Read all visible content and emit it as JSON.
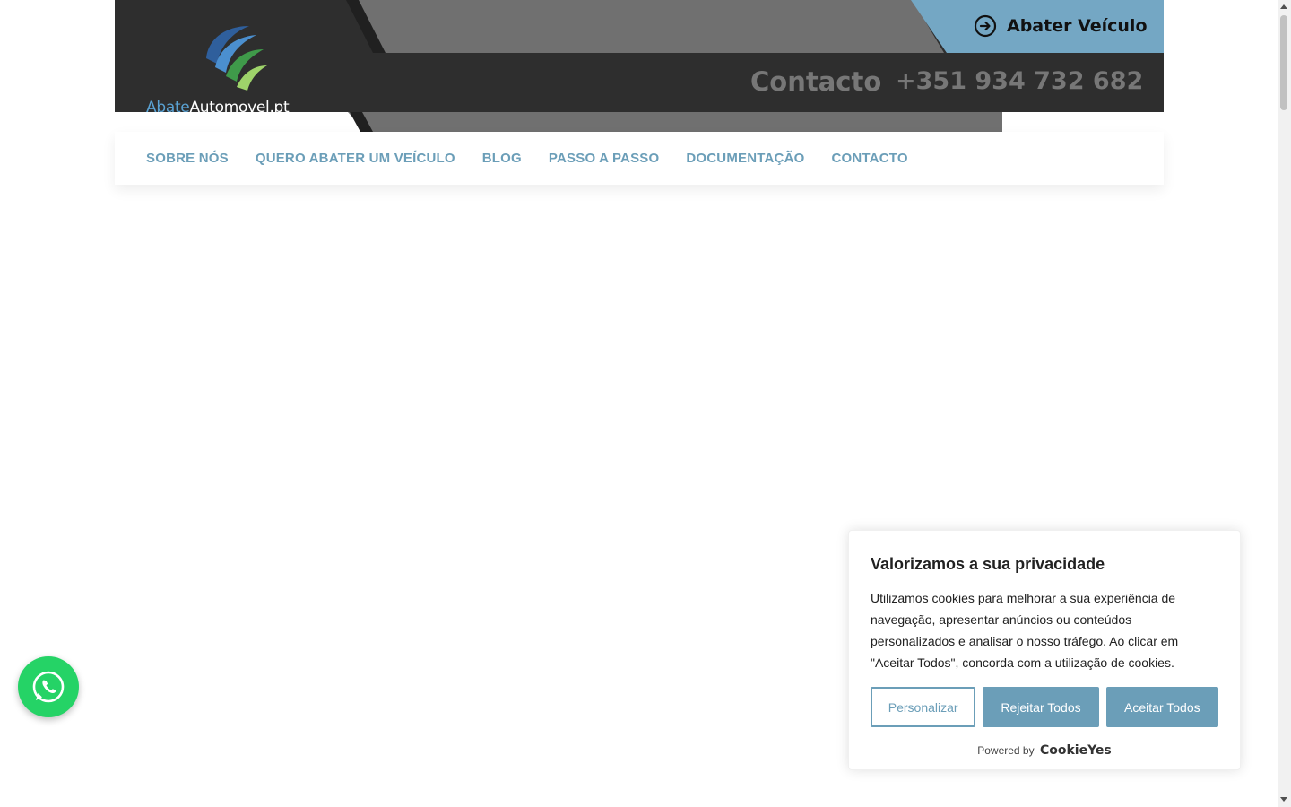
{
  "header": {
    "logo": {
      "part_a": "Abate",
      "part_b": "Automovel.pt",
      "icon": "globe-swoosh-logo"
    },
    "cta": {
      "label": "Abater Veículo",
      "icon": "arrow-circle-right-icon"
    },
    "contact_label": "Contacto",
    "phone": "+351 934 732 682"
  },
  "nav": {
    "items": [
      {
        "label": "SOBRE NÓS"
      },
      {
        "label": "QUERO ABATER UM VEÍCULO"
      },
      {
        "label": "BLOG"
      },
      {
        "label": "PASSO A PASSO"
      },
      {
        "label": "DOCUMENTAÇÃO"
      },
      {
        "label": "CONTACTO"
      }
    ]
  },
  "whatsapp": {
    "icon": "whatsapp-icon"
  },
  "cookie_banner": {
    "title": "Valorizamos a sua privacidade",
    "text": "Utilizamos cookies para melhorar a sua experiência de navegação, apresentar anúncios ou conteúdos personalizados e analisar o nosso tráfego. Ao clicar em \"Aceitar Todos\", concorda com a utilização de cookies.",
    "buttons": {
      "customize": "Personalizar",
      "reject": "Rejeitar Todos",
      "accept": "Aceitar Todos"
    },
    "powered_by": "Powered by",
    "brand": "CookieYes"
  },
  "colors": {
    "header_dark": "#2e2e2e",
    "header_mid": "#707070",
    "cta_blue": "#74a7c4",
    "nav_text": "#6b9eb8",
    "button_blue": "#6b9eb8",
    "whatsapp_green": "#25d366"
  }
}
